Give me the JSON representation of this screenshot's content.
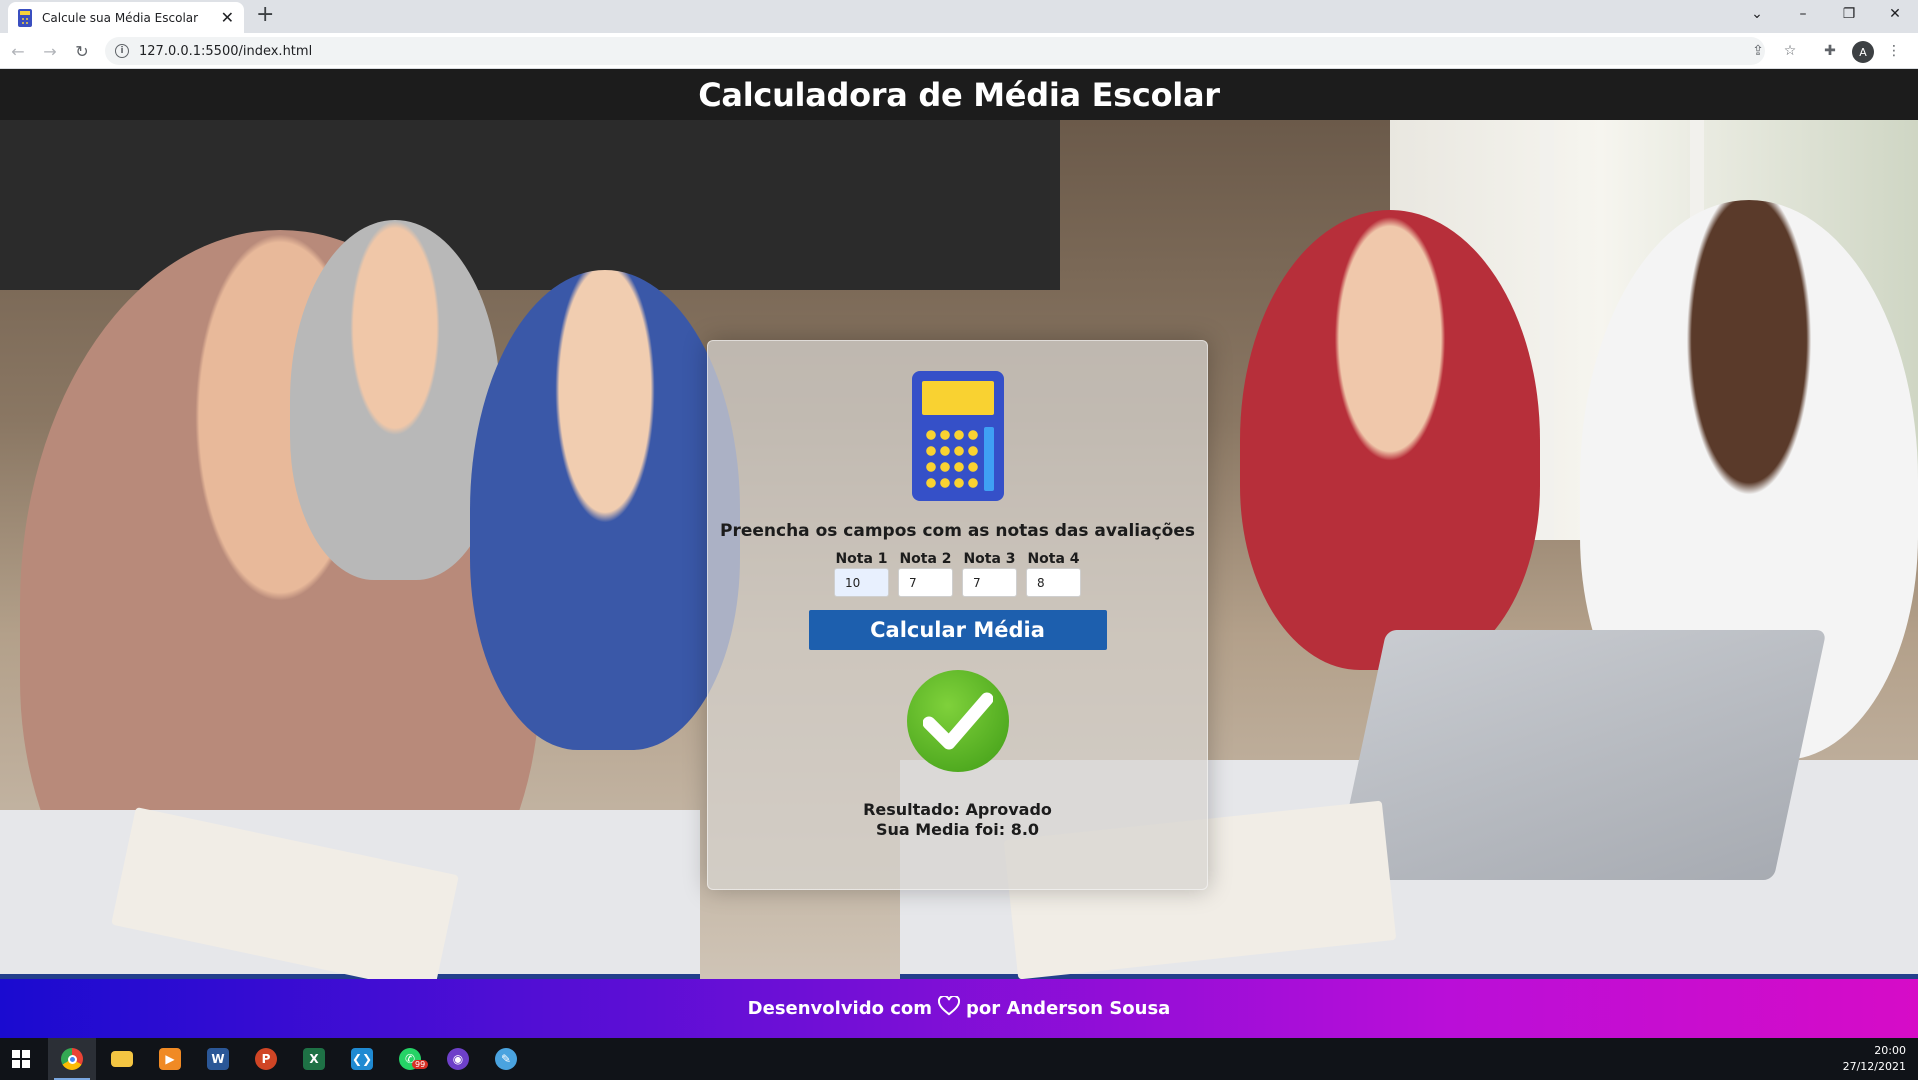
{
  "browser": {
    "tab_title": "Calcule sua Média Escolar",
    "url": "127.0.0.1:5500/index.html",
    "profile_initial": "A"
  },
  "page": {
    "title": "Calculadora de Média Escolar",
    "instruction": "Preencha os campos com as notas das avaliações",
    "notes": [
      {
        "label": "Nota 1",
        "value": "10"
      },
      {
        "label": "Nota 2",
        "value": "7"
      },
      {
        "label": "Nota 3",
        "value": "7"
      },
      {
        "label": "Nota 4",
        "value": "8"
      }
    ],
    "button_label": "Calcular Média",
    "result_line1": "Resultado: Aprovado",
    "result_line2": "Sua Media foi: 8.0",
    "footer_before": "Desenvolvido com",
    "footer_after": "por Anderson Sousa",
    "colors": {
      "header_bg": "#1c1c1c",
      "button": "#1d5fae",
      "check": "#5cb824"
    }
  },
  "taskbar": {
    "apps": [
      "chrome-icon",
      "file-explorer-icon",
      "media-player-icon",
      "word-icon",
      "powerpoint-icon",
      "excel-icon",
      "vscode-icon",
      "whatsapp-icon",
      "github-desktop-icon",
      "paint-icon"
    ],
    "whatsapp_badge": "99",
    "time": "20:00",
    "date": "27/12/2021"
  }
}
